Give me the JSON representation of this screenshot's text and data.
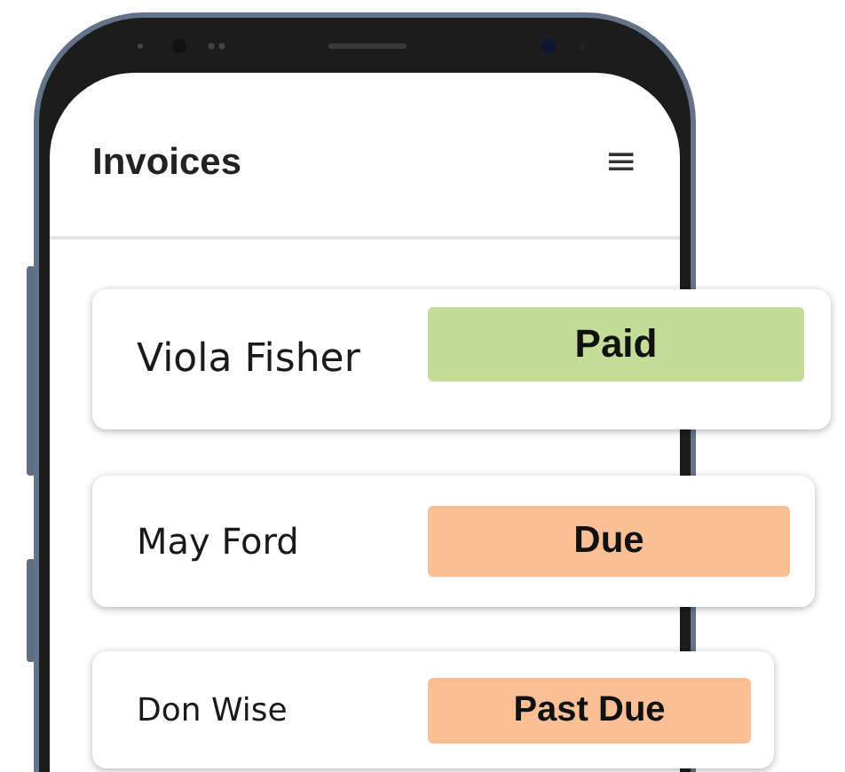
{
  "header": {
    "title": "Invoices",
    "menu_icon": "≡"
  },
  "invoices": [
    {
      "name": "Viola Fisher",
      "status": "Paid",
      "color": "#c3dc98"
    },
    {
      "name": "May Ford",
      "status": "Due",
      "color": "#fbbf95"
    },
    {
      "name": "Don Wise",
      "status": "Past Due",
      "color": "#fbbf95"
    }
  ]
}
